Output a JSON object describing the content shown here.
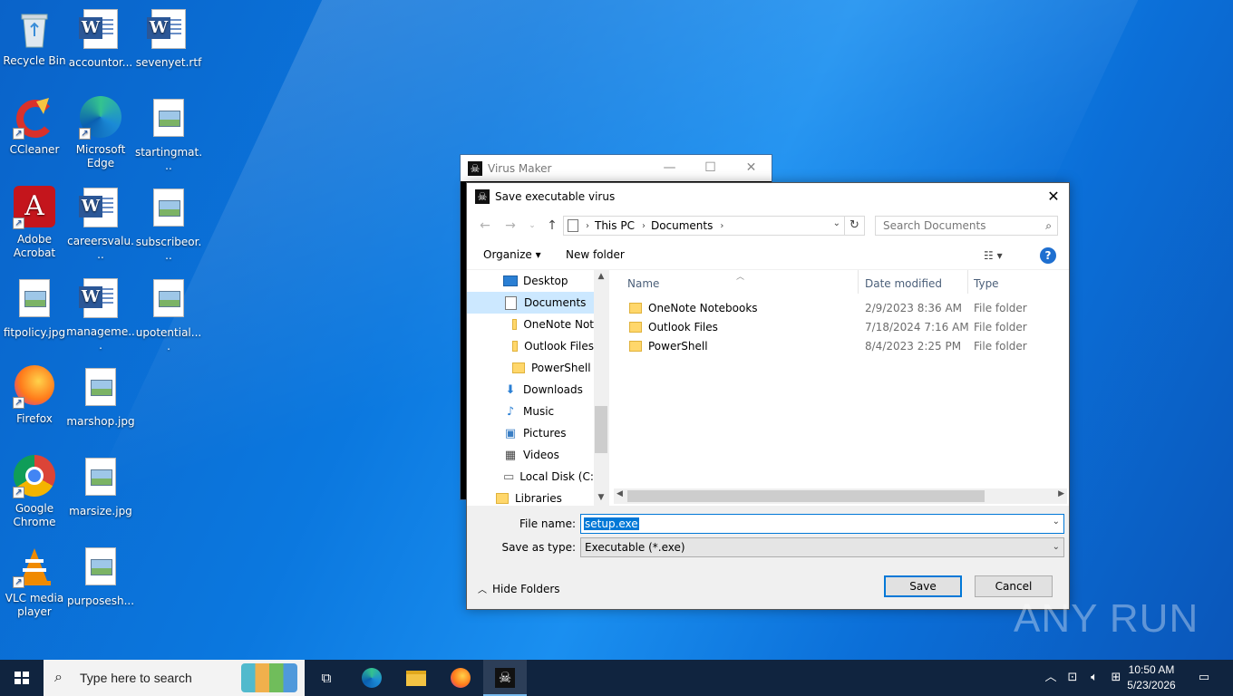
{
  "desktop": {
    "icons": [
      {
        "label": "Recycle Bin"
      },
      {
        "label": "accountor..."
      },
      {
        "label": "sevenyet.rtf"
      },
      {
        "label": "CCleaner"
      },
      {
        "label": "Microsoft Edge"
      },
      {
        "label": "startingmat..."
      },
      {
        "label": "Adobe Acrobat"
      },
      {
        "label": "careersvalu..."
      },
      {
        "label": "subscribeor..."
      },
      {
        "label": "fitpolicy.jpg"
      },
      {
        "label": "manageme..."
      },
      {
        "label": "upotential...."
      },
      {
        "label": "Firefox"
      },
      {
        "label": "marshop.jpg"
      },
      {
        "label": "Google Chrome"
      },
      {
        "label": "marsize.jpg"
      },
      {
        "label": "VLC media player"
      },
      {
        "label": "purposesh..."
      }
    ]
  },
  "virus_maker": {
    "title": "Virus Maker"
  },
  "dialog": {
    "title": "Save executable virus",
    "breadcrumb": [
      "This PC",
      "Documents"
    ],
    "search_placeholder": "Search Documents",
    "toolbar": {
      "organize": "Organize",
      "new_folder": "New folder"
    },
    "nav_items": [
      {
        "label": "Desktop"
      },
      {
        "label": "Documents"
      },
      {
        "label": "OneNote Not"
      },
      {
        "label": "Outlook Files"
      },
      {
        "label": "PowerShell"
      },
      {
        "label": "Downloads"
      },
      {
        "label": "Music"
      },
      {
        "label": "Pictures"
      },
      {
        "label": "Videos"
      },
      {
        "label": "Local Disk (C:)"
      },
      {
        "label": "Libraries"
      }
    ],
    "columns": {
      "name": "Name",
      "date": "Date modified",
      "type": "Type"
    },
    "files": [
      {
        "name": "OneNote Notebooks",
        "date": "2/9/2023 8:36 AM",
        "type": "File folder"
      },
      {
        "name": "Outlook Files",
        "date": "7/18/2024 7:16 AM",
        "type": "File folder"
      },
      {
        "name": "PowerShell",
        "date": "8/4/2023 2:25 PM",
        "type": "File folder"
      }
    ],
    "file_name_label": "File name:",
    "file_name_value": "setup.exe",
    "save_type_label": "Save as type:",
    "save_type_value": "Executable (*.exe)",
    "hide_folders": "Hide Folders",
    "save_button": "Save",
    "cancel_button": "Cancel"
  },
  "watermark": "ANY RUN",
  "taskbar": {
    "search_placeholder": "Type here to search",
    "time": "10:50 AM",
    "date": "5/23/2026"
  }
}
